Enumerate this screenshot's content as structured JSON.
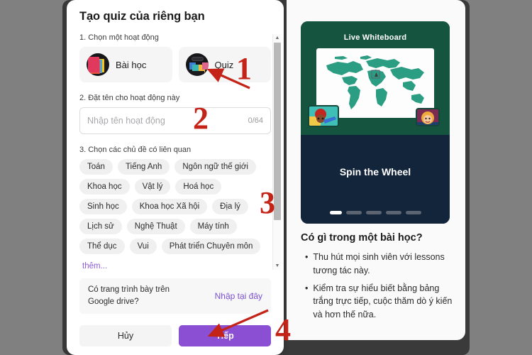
{
  "dialog": {
    "title": "Tạo quiz của riêng bạn",
    "step1_label": "1. Chọn một hoạt động",
    "activities": [
      {
        "label": "Bài học",
        "icon": "lesson-stack-icon"
      },
      {
        "label": "Quiz",
        "icon": "quiz-grid-icon"
      }
    ],
    "step2_label": "2. Đặt tên cho hoạt động này",
    "name_input": {
      "value": "",
      "placeholder": "Nhập tên hoạt động",
      "counter": "0/64"
    },
    "step3_label": "3. Chọn các chủ đề có liên quan",
    "topics": [
      "Toán",
      "Tiếng Anh",
      "Ngôn ngữ thế giới",
      "Khoa học",
      "Vật lý",
      "Hoá học",
      "Sinh học",
      "Khoa học Xã hội",
      "Địa lý",
      "Lịch sử",
      "Nghệ Thuật",
      "Máy tính",
      "Thể dục",
      "Vui",
      "Phát triển Chuyên môn"
    ],
    "more_link": "thêm...",
    "drive": {
      "question": "Có trang trình bày trên Google drive?",
      "link": "Nhập tại đây"
    },
    "buttons": {
      "cancel": "Hủy",
      "next": "Tiếp"
    }
  },
  "preview": {
    "slide_title": "Live Whiteboard",
    "spin_label": "Spin the Wheel",
    "carousel_dots": 5,
    "active_dot": 0,
    "heading": "Có gì trong một bài học?",
    "bullets": [
      "Thu hút mọi sinh viên với lessons tương tác này.",
      "Kiểm tra sự hiểu biết bằng bảng trắng trực tiếp, cuộc thăm dò ý kiến và hơn thế nữa."
    ]
  },
  "annotations": {
    "numbers": [
      "1",
      "2",
      "3",
      "4"
    ],
    "color": "#c42318"
  },
  "colors": {
    "accent_purple": "#8a4fd3",
    "link_purple": "#7b4fd0",
    "backdrop": "#808080",
    "app_window": "#3a3a3a",
    "slide_green": "#15543f",
    "slide_dark": "#13253b",
    "map_green": "#2a9d82"
  }
}
